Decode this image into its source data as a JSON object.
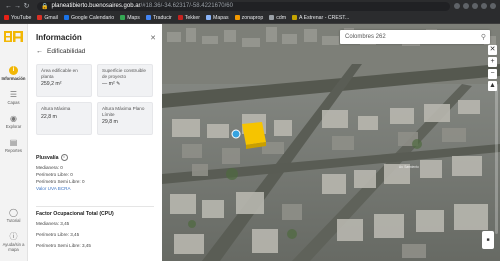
{
  "browser": {
    "url_host": "planeatibierto.buenosaires.gob.ar",
    "url_path": "/#18.36/-34.62317/-58.4221670/60",
    "bookmarks": [
      {
        "label": "YouTube",
        "color": "#e62117"
      },
      {
        "label": "Gmail",
        "color": "#d93025"
      },
      {
        "label": "Google Calendario",
        "color": "#1a73e8"
      },
      {
        "label": "Maps",
        "color": "#34a853"
      },
      {
        "label": "Traducir",
        "color": "#4285f4"
      },
      {
        "label": "Tekker",
        "color": "#c5221f"
      },
      {
        "label": "Mapas",
        "color": "#8ab4f8"
      },
      {
        "label": "zonaprop",
        "color": "#f29900"
      },
      {
        "label": "cdm",
        "color": "#9aa0a6"
      },
      {
        "label": "A Estrenar - CREST...",
        "color": "#c5a400"
      }
    ]
  },
  "rail": {
    "items": [
      {
        "label": "Información",
        "icon": "info-icon"
      },
      {
        "label": "Capas",
        "icon": "layers-icon"
      },
      {
        "label": "Explorar",
        "icon": "explore-icon"
      },
      {
        "label": "Reportes",
        "icon": "reports-icon"
      },
      {
        "label": "Tutorial",
        "icon": "tutorial-icon"
      },
      {
        "label": "Ayuda/sin a mapa",
        "icon": "help-icon"
      }
    ]
  },
  "panel": {
    "title": "Información",
    "back_label": "Edificabilidad",
    "cards": [
      {
        "label": "Área edificable en planta",
        "value": "259,2 m²"
      },
      {
        "label": "Superficie construible de proyecto",
        "value": "— m²"
      },
      {
        "label": "Altura Máxima",
        "value": "22,8 m"
      },
      {
        "label": "Altura Máxima Plano Límite",
        "value": "29,8 m"
      }
    ],
    "plusvalia": {
      "heading": "Plusvalía",
      "rows": [
        "Medianera: 0",
        "Perímetro Libre: 0",
        "Perímetro Semi Libre: 0"
      ],
      "link": "Valor UVA BCRA"
    },
    "fot": {
      "heading": "Factor Ocupacional Total (CPU)",
      "rows": [
        "Medianera: 3,45",
        "Perímetro Libre: 3,45",
        "Perímetro Semi Libre: 3,45"
      ]
    }
  },
  "map": {
    "search_value": "Colombres 262",
    "road_label": "Av. Sarmiento"
  },
  "colors": {
    "accent": "#f2b705",
    "link": "#3b74c4",
    "highlight": "#f6c400"
  }
}
